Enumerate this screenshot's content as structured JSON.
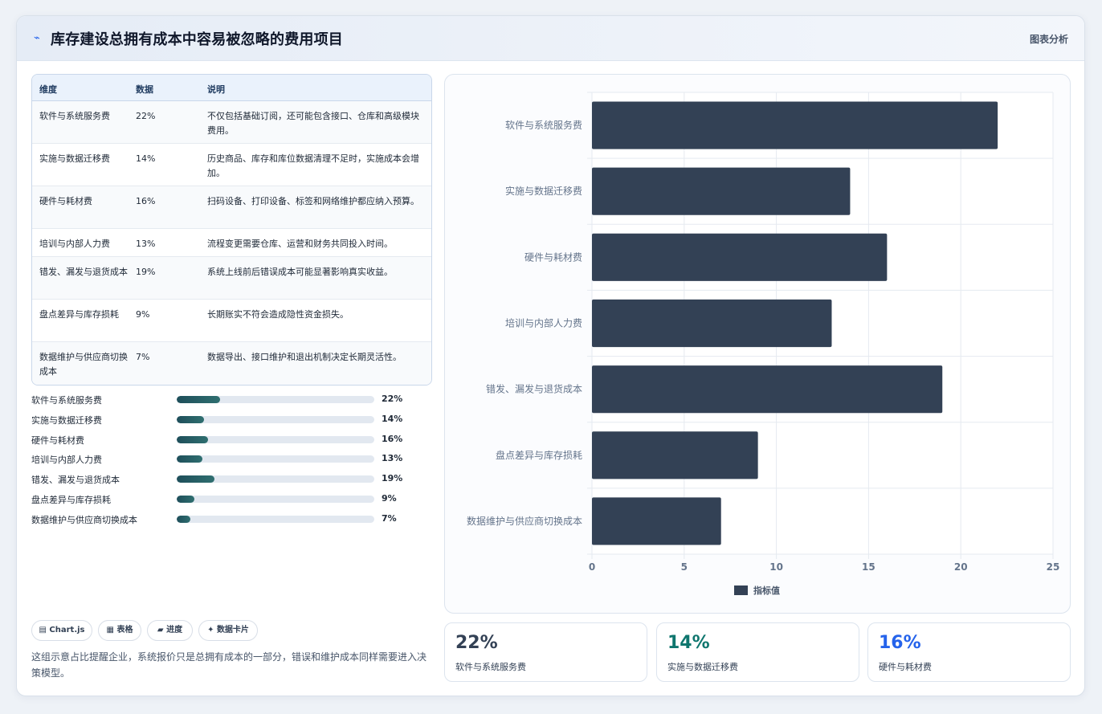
{
  "header": {
    "icon": "chart-line-icon",
    "title": "库存建设总拥有成本中容易被忽略的费用项目",
    "right_label": "图表分析"
  },
  "table": {
    "headers": [
      "维度",
      "数据",
      "说明"
    ],
    "rows": [
      {
        "dim": "软件与系统服务费",
        "value": "22%",
        "desc": "不仅包括基础订阅，还可能包含接口、仓库和高级模块费用。"
      },
      {
        "dim": "实施与数据迁移费",
        "value": "14%",
        "desc": "历史商品、库存和库位数据清理不足时，实施成本会增加。"
      },
      {
        "dim": "硬件与耗材费",
        "value": "16%",
        "desc": "扫码设备、打印设备、标签和网络维护都应纳入预算。"
      },
      {
        "dim": "培训与内部人力费",
        "value": "13%",
        "desc": "流程变更需要仓库、运营和财务共同投入时间。"
      },
      {
        "dim": "错发、漏发与退货成本",
        "value": "19%",
        "desc": "系统上线前后错误成本可能显著影响真实收益。"
      },
      {
        "dim": "盘点差异与库存损耗",
        "value": "9%",
        "desc": "长期账实不符会造成隐性资金损失。"
      },
      {
        "dim": "数据维护与供应商切换成本",
        "value": "7%",
        "desc": "数据导出、接口维护和退出机制决定长期灵活性。"
      }
    ]
  },
  "progress": [
    {
      "label": "软件与系统服务费",
      "value": 22,
      "text": "22%"
    },
    {
      "label": "实施与数据迁移费",
      "value": 14,
      "text": "14%"
    },
    {
      "label": "硬件与耗材费",
      "value": 16,
      "text": "16%"
    },
    {
      "label": "培训与内部人力费",
      "value": 13,
      "text": "13%"
    },
    {
      "label": "错发、漏发与退货成本",
      "value": 19,
      "text": "19%"
    },
    {
      "label": "盘点差异与库存损耗",
      "value": 9,
      "text": "9%"
    },
    {
      "label": "数据维护与供应商切换成本",
      "value": 7,
      "text": "7%"
    }
  ],
  "chips": [
    {
      "icon": "chart-icon",
      "glyph": "▤",
      "label": "Chart.js"
    },
    {
      "icon": "table-icon",
      "glyph": "▦",
      "label": "表格"
    },
    {
      "icon": "progress-icon",
      "glyph": "▰",
      "label": "进度"
    },
    {
      "icon": "sparkle-icon",
      "glyph": "✦",
      "label": "数据卡片"
    }
  ],
  "note": "这组示意占比提醒企业，系统报价只是总拥有成本的一部分，错误和维护成本同样需要进入决策模型。",
  "stats": [
    {
      "value": "22%",
      "label": "软件与系统服务费",
      "color": "#334155"
    },
    {
      "value": "14%",
      "label": "实施与数据迁移费",
      "color": "#0f766e"
    },
    {
      "value": "16%",
      "label": "硬件与耗材费",
      "color": "#2563eb"
    }
  ],
  "chart_data": {
    "type": "bar",
    "orientation": "horizontal",
    "categories": [
      "软件与系统服务费",
      "实施与数据迁移费",
      "硬件与耗材费",
      "培训与内部人力费",
      "错发、漏发与退货成本",
      "盘点差异与库存损耗",
      "数据维护与供应商切换成本"
    ],
    "series": [
      {
        "name": "指标值",
        "values": [
          22,
          14,
          16,
          13,
          19,
          9,
          7
        ],
        "color": "#334155"
      }
    ],
    "xlim": [
      0,
      25
    ],
    "xticks": [
      0,
      5,
      10,
      15,
      20,
      25
    ],
    "grid": true,
    "legend": "bottom"
  }
}
